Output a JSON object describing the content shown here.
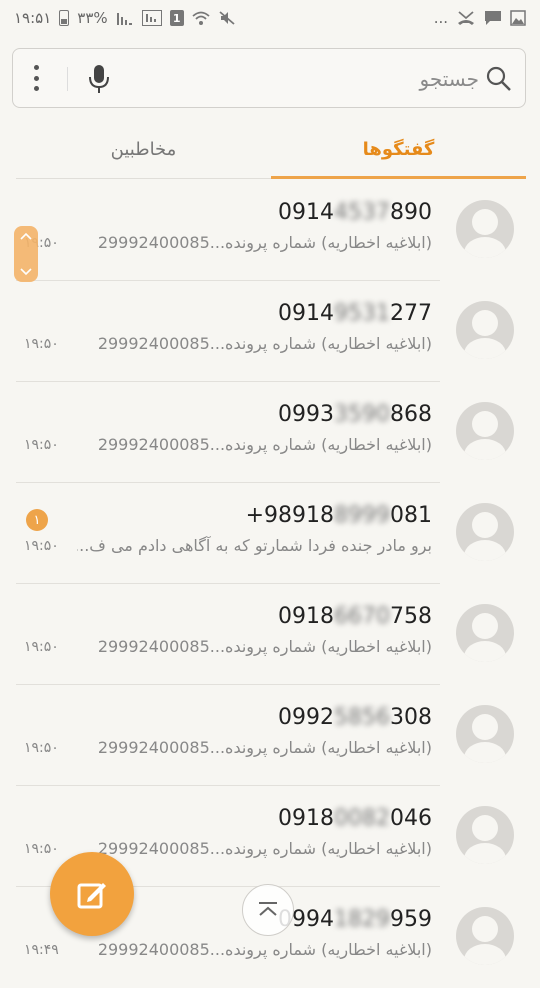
{
  "status_bar": {
    "time": "۱۹:۵۱",
    "battery_percent": "۳۳%",
    "sim_label": "1",
    "overflow": "..."
  },
  "search": {
    "placeholder": "جستجو"
  },
  "tabs": [
    {
      "label": "مخاطبین",
      "selected": false
    },
    {
      "label": "گفتگوها",
      "selected": true
    }
  ],
  "colors": {
    "accent": "#eea44a",
    "background": "#f7f6f2"
  },
  "conversations": [
    {
      "number_prefix": "0914",
      "number_hidden": "4537",
      "number_suffix": "890",
      "preview": "(ابلاغیه اخطاریه) شماره پرونده...29992400085",
      "time": "۱۹:۵۰",
      "unread": ""
    },
    {
      "number_prefix": "0914",
      "number_hidden": "9531",
      "number_suffix": "277",
      "preview": "(ابلاغیه اخطاریه) شماره پرونده...29992400085",
      "time": "۱۹:۵۰",
      "unread": ""
    },
    {
      "number_prefix": "0993",
      "number_hidden": "3590",
      "number_suffix": "868",
      "preview": "(ابلاغیه اخطاریه) شماره پرونده...29992400085",
      "time": "۱۹:۵۰",
      "unread": ""
    },
    {
      "number_prefix": "+98918",
      "number_hidden": "8999",
      "number_suffix": "081",
      "preview": "برو مادر جنده فردا شمارتو که به آگاهی دادم می ف...",
      "time": "۱۹:۵۰",
      "unread": "۱"
    },
    {
      "number_prefix": "0918",
      "number_hidden": "6670",
      "number_suffix": "758",
      "preview": "(ابلاغیه اخطاریه) شماره پرونده...29992400085",
      "time": "۱۹:۵۰",
      "unread": ""
    },
    {
      "number_prefix": "0992",
      "number_hidden": "5856",
      "number_suffix": "308",
      "preview": "(ابلاغیه اخطاریه) شماره پرونده...29992400085",
      "time": "۱۹:۵۰",
      "unread": ""
    },
    {
      "number_prefix": "0918",
      "number_hidden": "0082",
      "number_suffix": "046",
      "preview": "(ابلاغیه اخطاریه) شماره پرونده...29992400085",
      "time": "۱۹:۵۰",
      "unread": ""
    },
    {
      "number_prefix": "0994",
      "number_hidden": "1829",
      "number_suffix": "959",
      "preview": "(ابلاغیه اخطاریه) شماره پرونده...29992400085",
      "time": "۱۹:۴۹",
      "unread": ""
    }
  ]
}
